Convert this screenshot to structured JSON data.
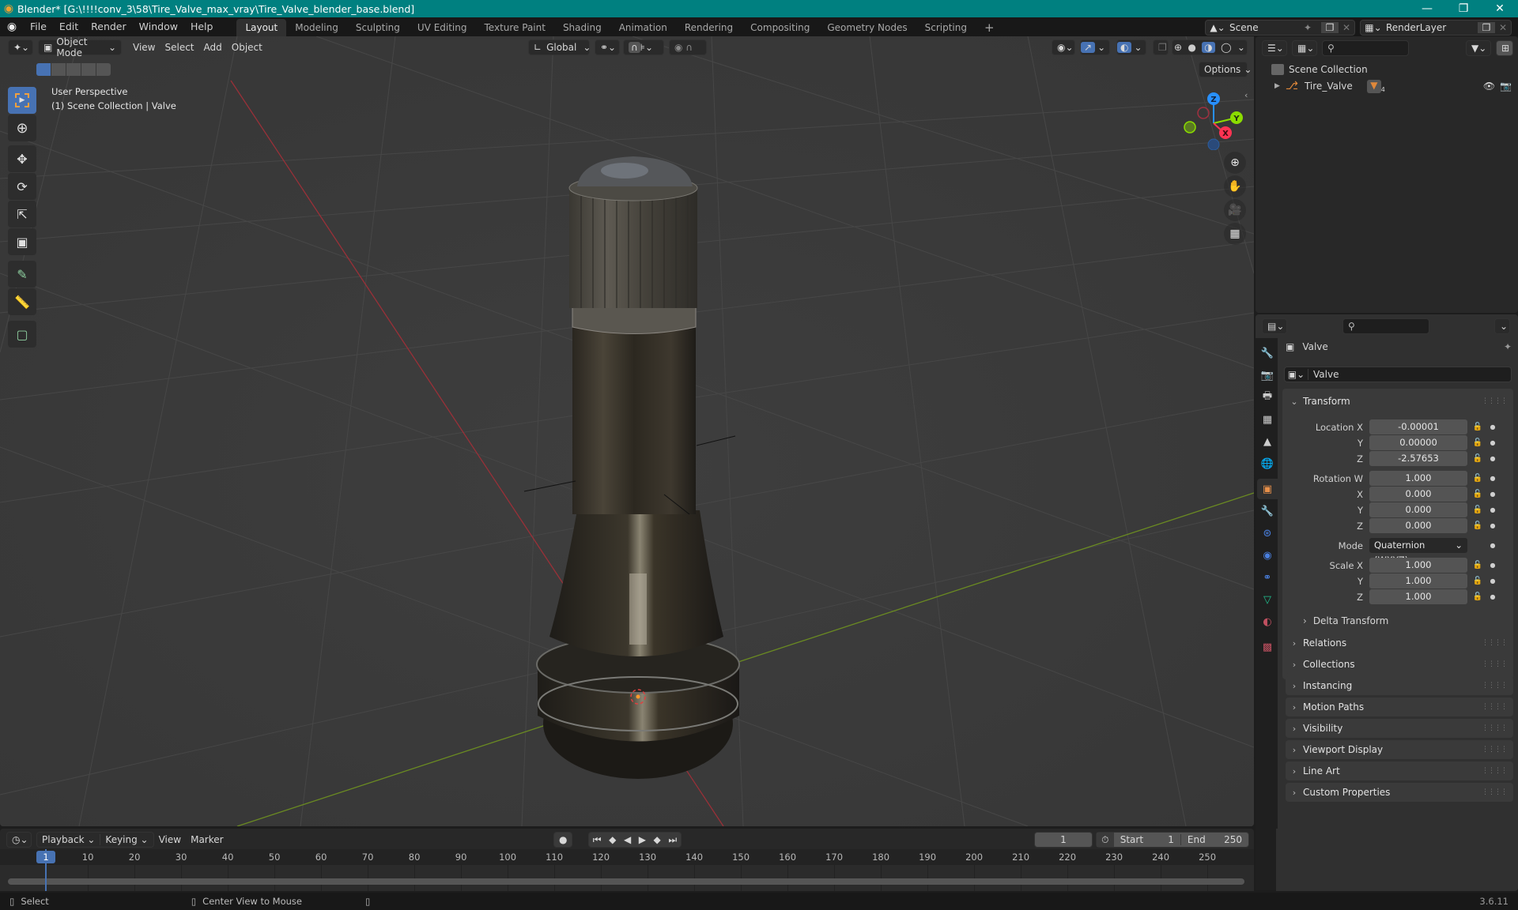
{
  "window": {
    "title": "Blender* [G:\\!!!!conv_3\\58\\Tire_Valve_max_vray\\Tire_Valve_blender_base.blend]",
    "controls": [
      "minimize",
      "maximize",
      "close"
    ]
  },
  "menubar": {
    "items": [
      "File",
      "Edit",
      "Render",
      "Window",
      "Help"
    ],
    "workspaces": [
      "Layout",
      "Modeling",
      "Sculpting",
      "UV Editing",
      "Texture Paint",
      "Shading",
      "Animation",
      "Rendering",
      "Compositing",
      "Geometry Nodes",
      "Scripting"
    ],
    "active_workspace": "Layout",
    "add_workspace": "+",
    "scene": "Scene",
    "render_layer": "RenderLayer"
  },
  "viewport": {
    "mode": "Object Mode",
    "menus": [
      "View",
      "Select",
      "Add",
      "Object"
    ],
    "orientation": "Global",
    "options_label": "Options",
    "overlay_line1": "User Perspective",
    "overlay_line2": "(1) Scene Collection | Valve",
    "gizmo_axes": {
      "x": "X",
      "y": "Y",
      "z": "Z"
    },
    "axis_colors": {
      "x": "#ff3352",
      "y": "#8bdc00",
      "z": "#2890ff"
    },
    "tools": [
      "select-box",
      "cursor",
      "move",
      "rotate",
      "scale",
      "transform",
      "annotate",
      "measure",
      "add-cube"
    ],
    "nav_buttons": [
      "zoom",
      "pan",
      "camera",
      "ortho-grid"
    ]
  },
  "outliner": {
    "root": "Scene Collection",
    "items": [
      {
        "name": "Tire_Valve",
        "modifier_count": "4"
      }
    ]
  },
  "properties": {
    "object_name": "Valve",
    "datablock_name": "Valve",
    "transform_label": "Transform",
    "location": {
      "label": "Location X",
      "x": "-0.00001",
      "y": "0.00000",
      "z": "-2.57653"
    },
    "rotation": {
      "label": "Rotation W",
      "w": "1.000",
      "x": "0.000",
      "y": "0.000",
      "z": "0.000"
    },
    "mode": {
      "label": "Mode",
      "value": "Quaternion (WXYZ)"
    },
    "scale": {
      "label": "Scale X",
      "x": "1.000",
      "y": "1.000",
      "z": "1.000"
    },
    "axis_labels": {
      "x": "X",
      "y": "Y",
      "z": "Z"
    },
    "delta_transform": "Delta Transform",
    "panels": [
      "Relations",
      "Collections",
      "Instancing",
      "Motion Paths",
      "Visibility",
      "Viewport Display",
      "Line Art",
      "Custom Properties"
    ]
  },
  "timeline": {
    "menus": [
      "Playback",
      "Keying",
      "View",
      "Marker"
    ],
    "current_frame": "1",
    "start_label": "Start",
    "start": "1",
    "end_label": "End",
    "end": "250",
    "ticks": [
      "10",
      "20",
      "30",
      "40",
      "50",
      "60",
      "70",
      "80",
      "90",
      "100",
      "110",
      "120",
      "130",
      "140",
      "150",
      "160",
      "170",
      "180",
      "190",
      "200",
      "210",
      "220",
      "230",
      "240",
      "250"
    ],
    "playhead": "1"
  },
  "statusbar": {
    "left_action": "Select",
    "middle_action": "Center View to Mouse",
    "version": "3.6.11"
  }
}
